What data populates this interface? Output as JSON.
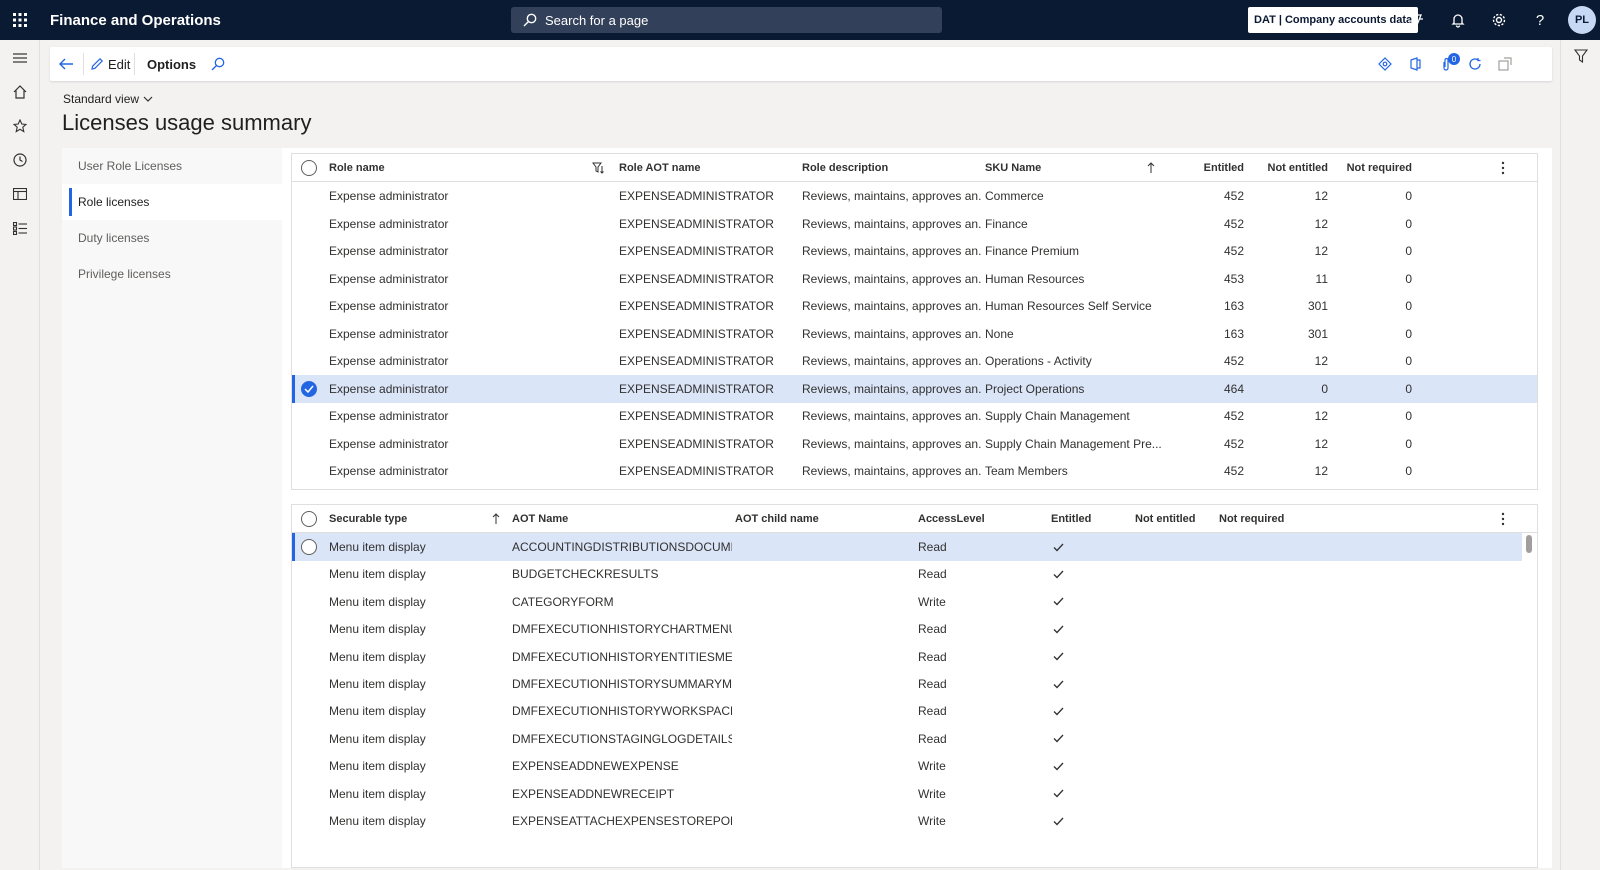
{
  "app": {
    "title": "Finance and Operations",
    "search_placeholder": "Search for a page",
    "company": "DAT | Company accounts data",
    "avatar_initials": "PL"
  },
  "actionpane": {
    "edit_label": "Edit",
    "options_label": "Options",
    "badge_count": "0"
  },
  "page": {
    "view": "Standard view",
    "title": "Licenses usage summary"
  },
  "tabs": [
    "User Role Licenses",
    "Role licenses",
    "Duty licenses",
    "Privilege licenses"
  ],
  "active_tab": "Role licenses",
  "roles_grid": {
    "headers": {
      "role_name": "Role name",
      "aot_name": "Role AOT name",
      "description": "Role description",
      "sku": "SKU Name",
      "entitled": "Entitled",
      "not_entitled": "Not entitled",
      "not_required": "Not required"
    },
    "rows": [
      {
        "role": "Expense administrator",
        "aot": "EXPENSEADMINISTRATOR",
        "desc": "Reviews, maintains, approves an...",
        "sku": "Commerce",
        "entitled": "452",
        "not_entitled": "12",
        "not_required": "0"
      },
      {
        "role": "Expense administrator",
        "aot": "EXPENSEADMINISTRATOR",
        "desc": "Reviews, maintains, approves an...",
        "sku": "Finance",
        "entitled": "452",
        "not_entitled": "12",
        "not_required": "0"
      },
      {
        "role": "Expense administrator",
        "aot": "EXPENSEADMINISTRATOR",
        "desc": "Reviews, maintains, approves an...",
        "sku": "Finance Premium",
        "entitled": "452",
        "not_entitled": "12",
        "not_required": "0"
      },
      {
        "role": "Expense administrator",
        "aot": "EXPENSEADMINISTRATOR",
        "desc": "Reviews, maintains, approves an...",
        "sku": "Human Resources",
        "entitled": "453",
        "not_entitled": "11",
        "not_required": "0"
      },
      {
        "role": "Expense administrator",
        "aot": "EXPENSEADMINISTRATOR",
        "desc": "Reviews, maintains, approves an...",
        "sku": "Human Resources Self Service",
        "entitled": "163",
        "not_entitled": "301",
        "not_required": "0"
      },
      {
        "role": "Expense administrator",
        "aot": "EXPENSEADMINISTRATOR",
        "desc": "Reviews, maintains, approves an...",
        "sku": "None",
        "entitled": "163",
        "not_entitled": "301",
        "not_required": "0"
      },
      {
        "role": "Expense administrator",
        "aot": "EXPENSEADMINISTRATOR",
        "desc": "Reviews, maintains, approves an...",
        "sku": "Operations - Activity",
        "entitled": "452",
        "not_entitled": "12",
        "not_required": "0"
      },
      {
        "role": "Expense administrator",
        "aot": "EXPENSEADMINISTRATOR",
        "desc": "Reviews, maintains, approves an...",
        "sku": "Project Operations",
        "entitled": "464",
        "not_entitled": "0",
        "not_required": "0"
      },
      {
        "role": "Expense administrator",
        "aot": "EXPENSEADMINISTRATOR",
        "desc": "Reviews, maintains, approves an...",
        "sku": "Supply Chain Management",
        "entitled": "452",
        "not_entitled": "12",
        "not_required": "0"
      },
      {
        "role": "Expense administrator",
        "aot": "EXPENSEADMINISTRATOR",
        "desc": "Reviews, maintains, approves an...",
        "sku": "Supply Chain Management Pre...",
        "entitled": "452",
        "not_entitled": "12",
        "not_required": "0"
      },
      {
        "role": "Expense administrator",
        "aot": "EXPENSEADMINISTRATOR",
        "desc": "Reviews, maintains, approves an...",
        "sku": "Team Members",
        "entitled": "452",
        "not_entitled": "12",
        "not_required": "0"
      }
    ],
    "selected_index": 7
  },
  "securables_grid": {
    "headers": {
      "type": "Securable type",
      "aot_name": "AOT Name",
      "child": "AOT child name",
      "access": "AccessLevel",
      "entitled": "Entitled",
      "not_entitled": "Not entitled",
      "not_required": "Not required"
    },
    "rows": [
      {
        "type": "Menu item display",
        "aot": "ACCOUNTINGDISTRIBUTIONSDOCUME...",
        "child": "",
        "access": "Read",
        "entitled": true
      },
      {
        "type": "Menu item display",
        "aot": "BUDGETCHECKRESULTS",
        "child": "",
        "access": "Read",
        "entitled": true
      },
      {
        "type": "Menu item display",
        "aot": "CATEGORYFORM",
        "child": "",
        "access": "Write",
        "entitled": true
      },
      {
        "type": "Menu item display",
        "aot": "DMFEXECUTIONHISTORYCHARTMENUIT...",
        "child": "",
        "access": "Read",
        "entitled": true
      },
      {
        "type": "Menu item display",
        "aot": "DMFEXECUTIONHISTORYENTITIESMEN...",
        "child": "",
        "access": "Read",
        "entitled": true
      },
      {
        "type": "Menu item display",
        "aot": "DMFEXECUTIONHISTORYSUMMARYME...",
        "child": "",
        "access": "Read",
        "entitled": true
      },
      {
        "type": "Menu item display",
        "aot": "DMFEXECUTIONHISTORYWORKSPACE",
        "child": "",
        "access": "Read",
        "entitled": true
      },
      {
        "type": "Menu item display",
        "aot": "DMFEXECUTIONSTAGINGLOGDETAILS",
        "child": "",
        "access": "Read",
        "entitled": true
      },
      {
        "type": "Menu item display",
        "aot": "EXPENSEADDNEWEXPENSE",
        "child": "",
        "access": "Write",
        "entitled": true
      },
      {
        "type": "Menu item display",
        "aot": "EXPENSEADDNEWRECEIPT",
        "child": "",
        "access": "Write",
        "entitled": true
      },
      {
        "type": "Menu item display",
        "aot": "EXPENSEATTACHEXPENSESTOREPORT",
        "child": "",
        "access": "Write",
        "entitled": true
      }
    ],
    "selected_index": 0
  },
  "colors": {
    "topbar": "#0b1a33",
    "accent": "#2266e3",
    "selected_row": "#dbe5f8"
  }
}
